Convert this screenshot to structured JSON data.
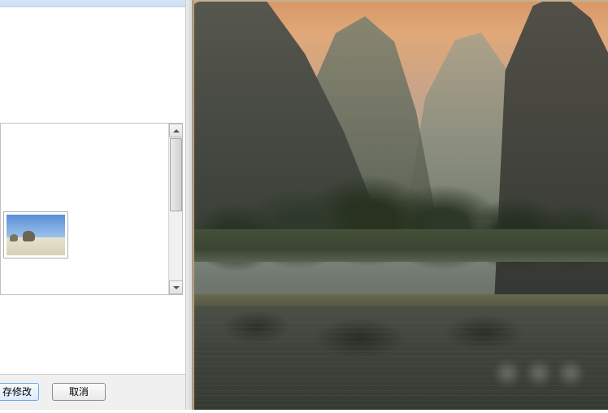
{
  "buttons": {
    "save_label": "存修改",
    "cancel_label": "取消"
  },
  "thumbnails": [
    {
      "name": "beach-thumbnail"
    }
  ],
  "preview": {
    "scene": "karst-mountains-river-sunset"
  },
  "colors": {
    "sky": "#d89868",
    "mountain_dark": "#3a4038",
    "water": "#3e443c",
    "accent_blue": "#6fa7df"
  }
}
